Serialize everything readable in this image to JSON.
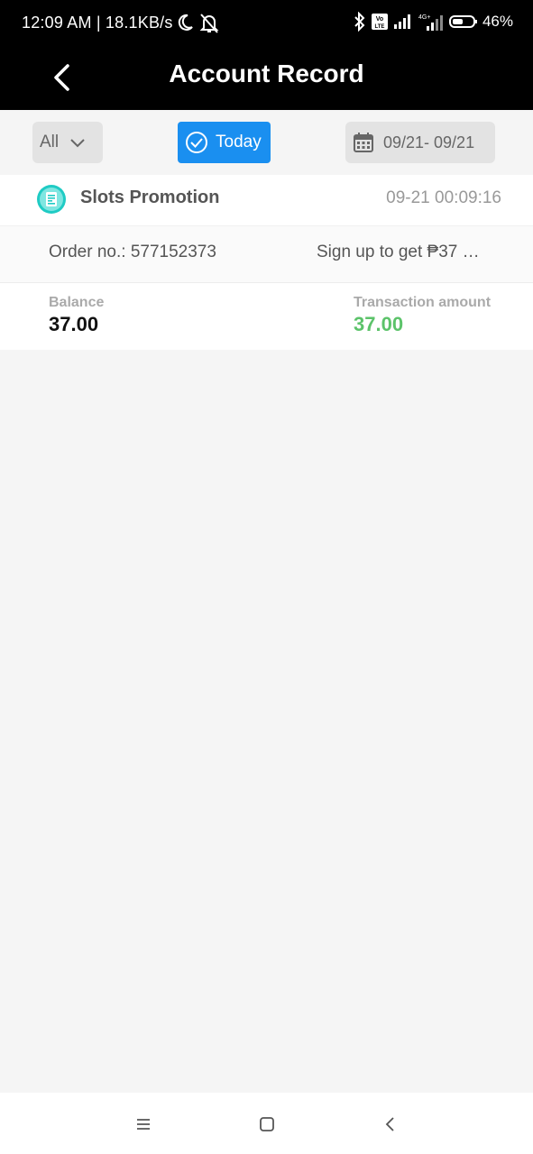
{
  "status_bar": {
    "time": "12:09 AM | 18.1KB/s",
    "battery": "46%",
    "icons": [
      "moon-icon",
      "bell-off-icon",
      "bluetooth-icon",
      "volte-icon",
      "signal-icon",
      "signal-4g-icon",
      "battery-icon"
    ],
    "network_label": "4G+",
    "volte_label": "Vo LTE"
  },
  "header": {
    "title": "Account Record",
    "back_icon": "chevron-left-icon"
  },
  "filters": {
    "type_select": "All",
    "today_label": "Today",
    "date_range": "09/21- 09/21",
    "accent_color": "#1a8ff0"
  },
  "records": [
    {
      "title": "Slots Promotion",
      "time": "09-21 00:09:16",
      "order_no": "Order no.: 577152373",
      "description": "Sign up to get ₱37 …",
      "balance_label": "Balance",
      "balance": "37.00",
      "amount_label": "Transaction amount",
      "amount": "37.00",
      "amount_color": "#5cc36a"
    }
  ],
  "nav_bar": {
    "icons": [
      "menu-icon",
      "home-square-icon",
      "back-chevron-icon"
    ]
  }
}
